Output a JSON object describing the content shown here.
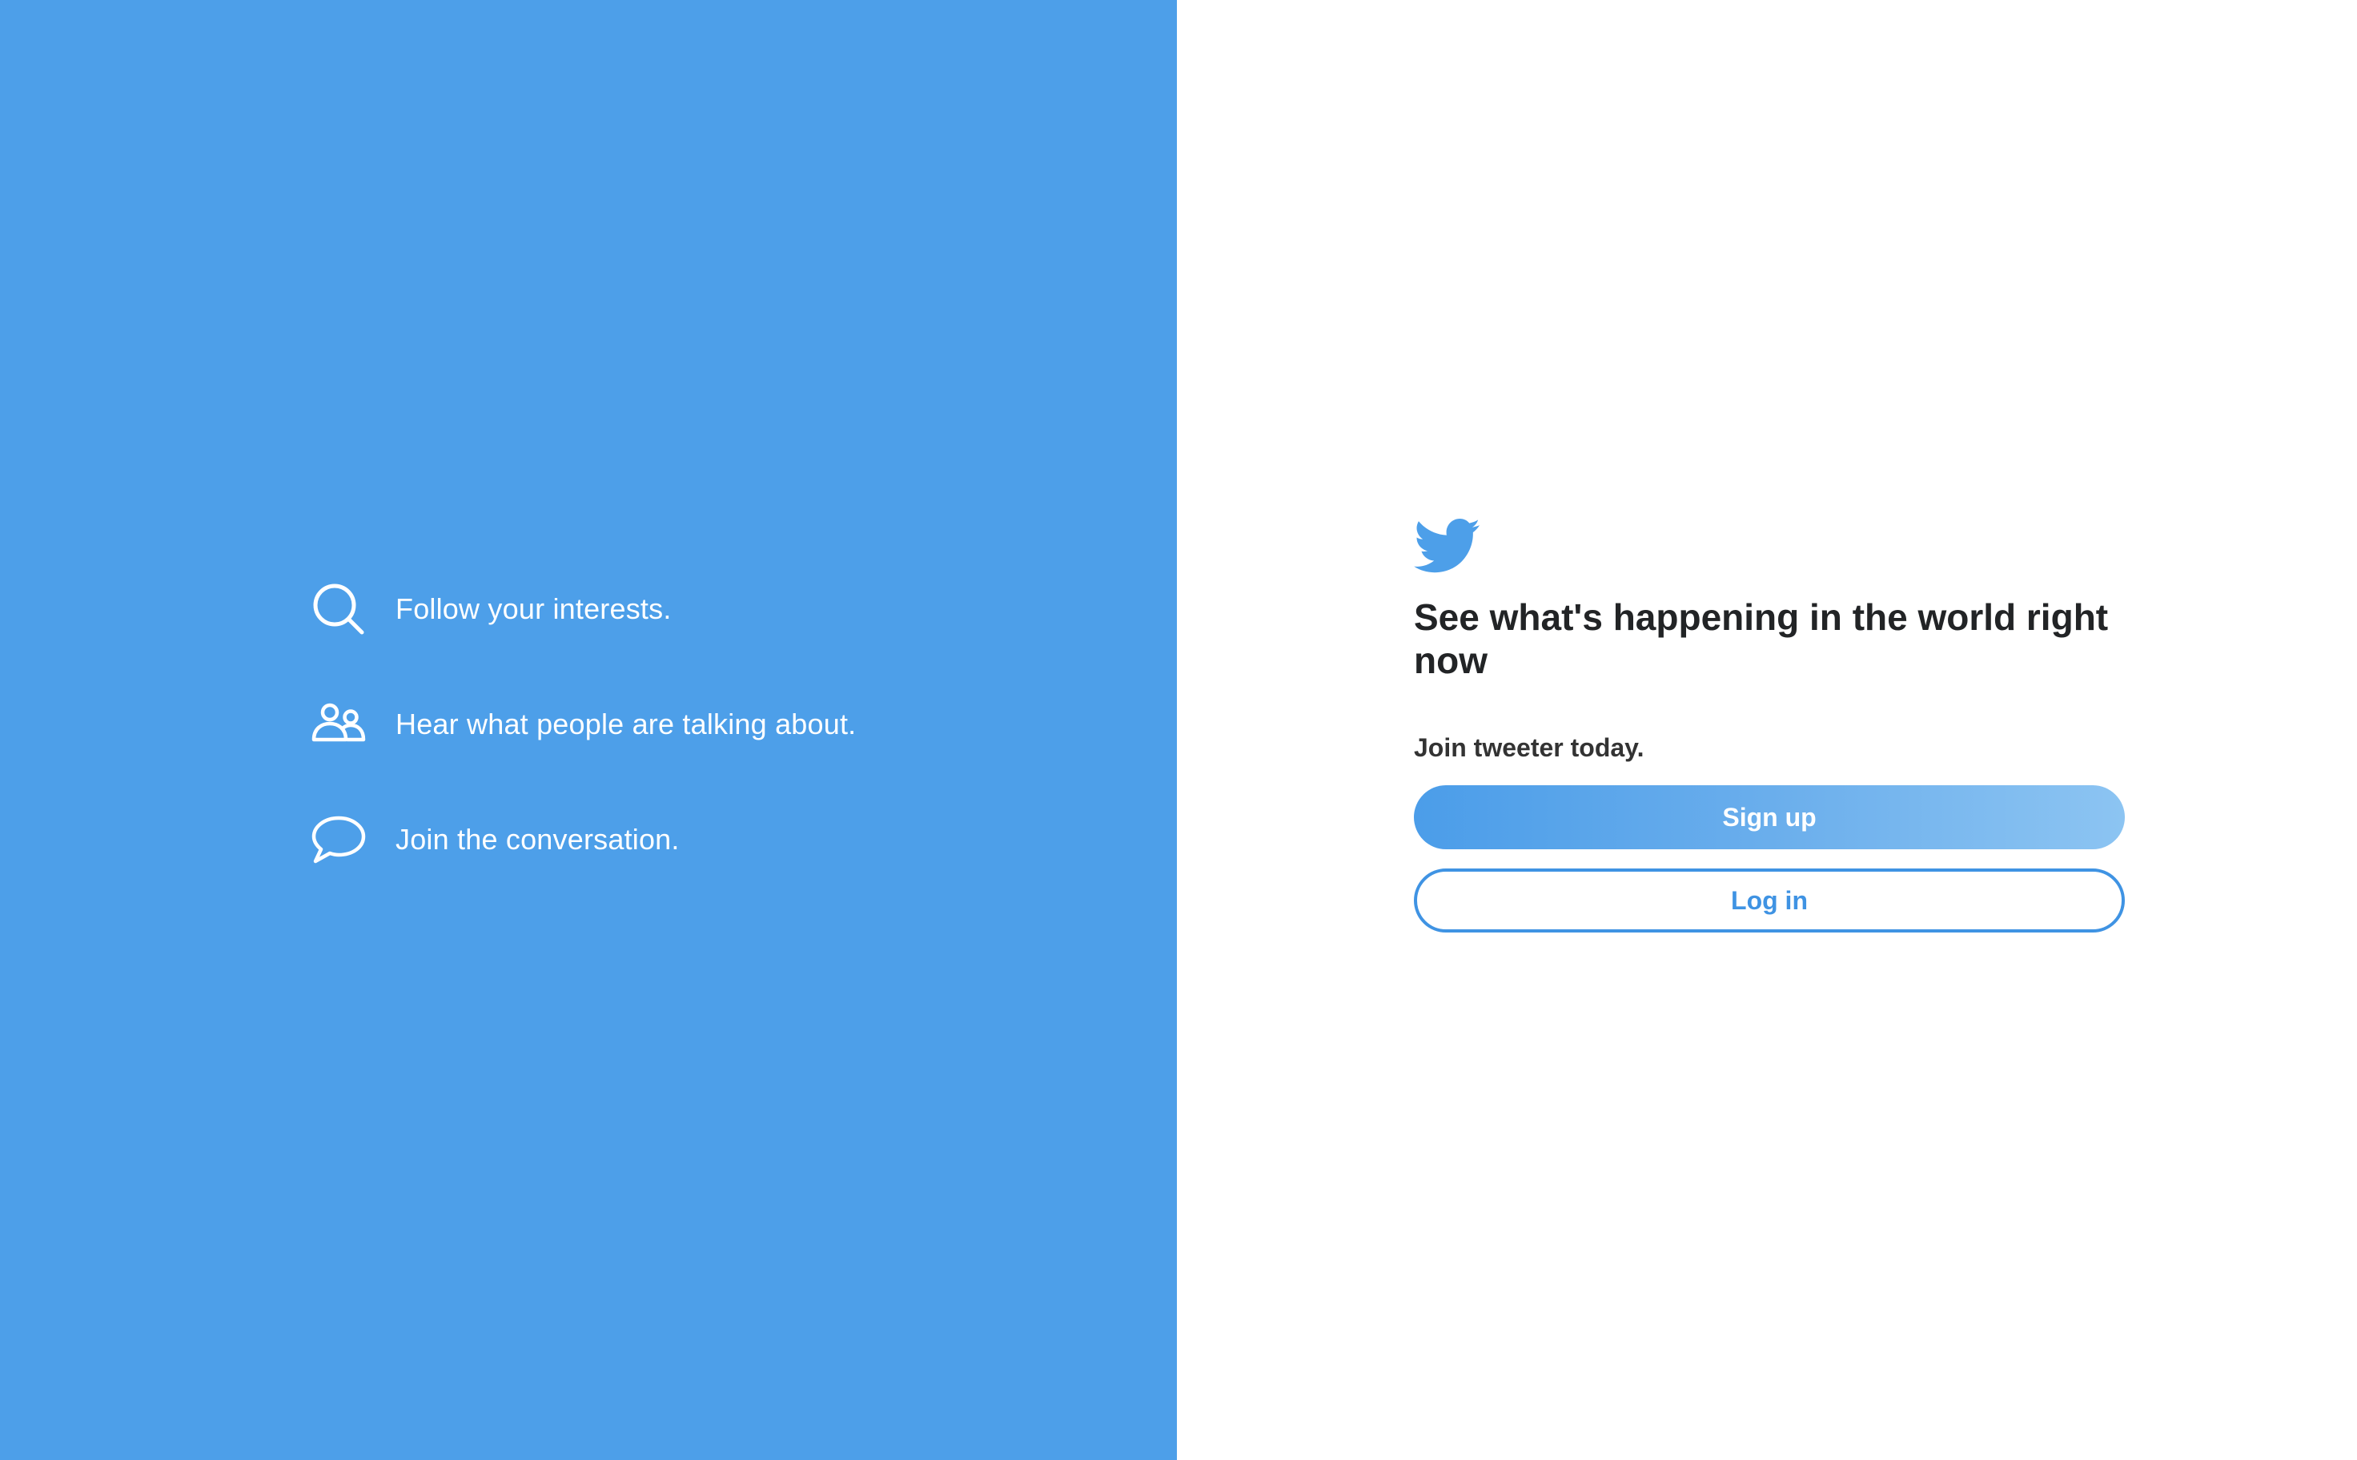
{
  "colors": {
    "brand_blue": "#4d9fe9",
    "text_dark": "#222426",
    "button_border": "#3f93e3"
  },
  "features": [
    {
      "icon": "search-icon",
      "text": "Follow your interests."
    },
    {
      "icon": "people-icon",
      "text": "Hear what people are talking about."
    },
    {
      "icon": "speech-bubble-icon",
      "text": "Join the conversation."
    }
  ],
  "auth": {
    "logo_icon": "bird-logo-icon",
    "headline": "See what's happening in the world right now",
    "subline": "Join tweeter today.",
    "signup_label": "Sign up",
    "login_label": "Log in"
  }
}
